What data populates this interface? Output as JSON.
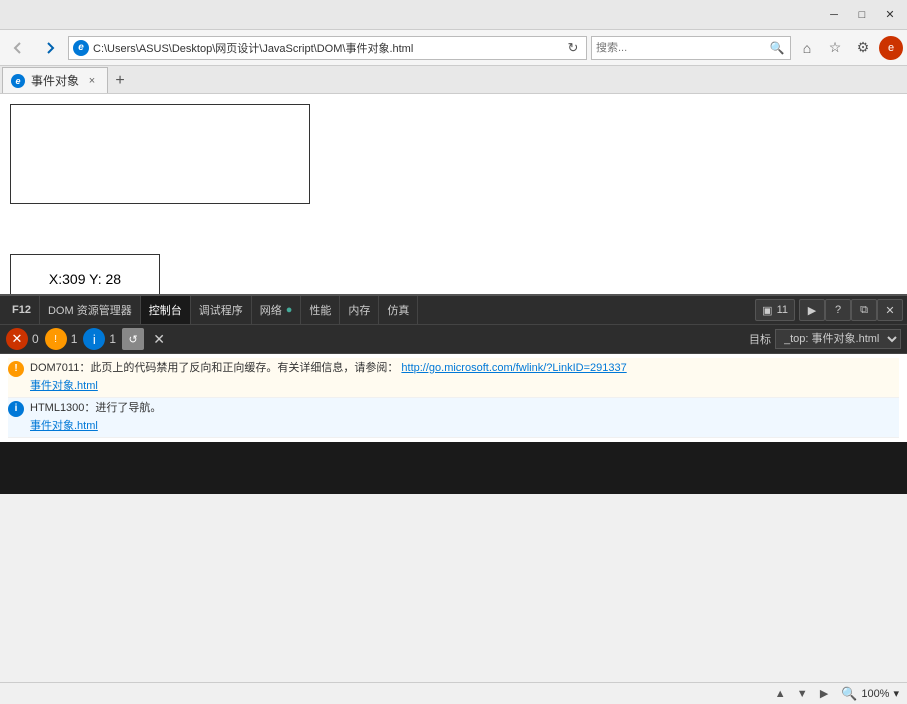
{
  "titlebar": {
    "minimize_label": "─",
    "maximize_label": "□",
    "close_label": "✕"
  },
  "navbar": {
    "back_label": "◀",
    "forward_label": "▶",
    "address": "C:\\Users\\ASUS\\Desktop\\网页设计\\JavaScript\\DOM\\事件对象.html",
    "refresh_label": "↻",
    "search_placeholder": "搜索...",
    "search_label": "🔍",
    "home_label": "⌂",
    "favorites_label": "★",
    "settings_label": "⚙",
    "user_label": "e"
  },
  "tabs": {
    "tab1_label": "事件对象",
    "tab1_close": "×",
    "new_tab_label": "+"
  },
  "content": {
    "coord_text": "X:309 Y: 28"
  },
  "devtools": {
    "f12_label": "F12",
    "dom_label": "DOM 资源管理器",
    "console_label": "控制台",
    "debugger_label": "调试程序",
    "network_label": "网络",
    "performance_label": "性能",
    "memory_label": "内存",
    "simulation_label": "仿真",
    "monitor_label": "▣",
    "monitor_count": "11",
    "play_label": "▶",
    "help_label": "?",
    "dock_label": "⧉",
    "close_label": "✕",
    "error_count": "0",
    "warning_count": "1",
    "info_count": "1",
    "refresh_icon": "↺",
    "clear_icon": "✕",
    "target_label": "目标",
    "target_value": "_top: 事件对象.html",
    "console_lines": [
      {
        "type": "warning",
        "icon": "!",
        "text": "DOM7011：此页上的代码禁用了反向和正向缓存。有关详细信息，请参阅：",
        "link": "http://go.microsoft.com/fwlink/?LinkID=291337",
        "file": "事件对象.html"
      },
      {
        "type": "info",
        "icon": "i",
        "text": "HTML1300：进行了导航。",
        "file": "事件对象.html"
      }
    ]
  },
  "statusbar": {
    "zoom_label": "100%",
    "zoom_icon": "🔍"
  }
}
